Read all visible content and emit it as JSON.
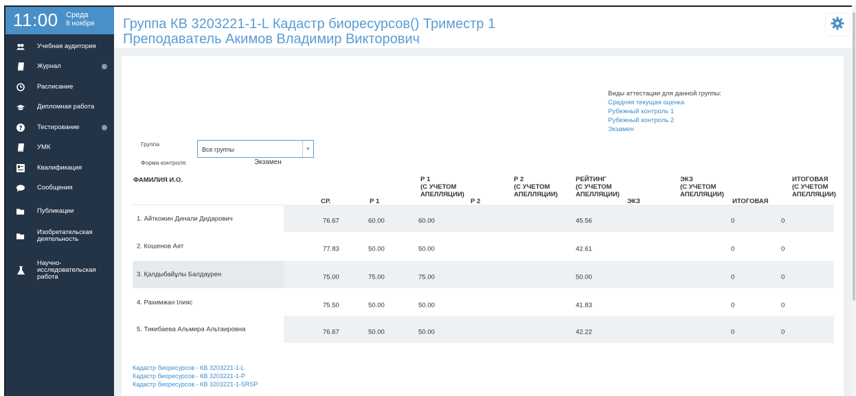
{
  "clock": {
    "time": "11:00",
    "day": "Среда",
    "date": "8 ноября"
  },
  "sidebar": {
    "items": [
      {
        "label": "Учебная аудитория",
        "icon": "users-icon",
        "has_sub": false
      },
      {
        "label": "Журнал",
        "icon": "book-icon",
        "has_sub": true
      },
      {
        "label": "Расписание",
        "icon": "clock-icon",
        "has_sub": false
      },
      {
        "label": "Дипломная работа",
        "icon": "graduation-cap-icon",
        "has_sub": false
      },
      {
        "label": "Тестирование",
        "icon": "question-icon",
        "has_sub": true
      },
      {
        "label": "УМК",
        "icon": "book-icon",
        "has_sub": false
      },
      {
        "label": "Квалификация",
        "icon": "id-card-icon",
        "has_sub": false
      },
      {
        "label": "Сообщения",
        "icon": "chat-icon",
        "has_sub": false
      },
      {
        "label": "Публикации",
        "icon": "folder-icon",
        "has_sub": false
      },
      {
        "label": "Изобретательская\nдеятельность",
        "icon": "folder-icon",
        "has_sub": false
      },
      {
        "label": "Научно-\nисследовательская\nработа",
        "icon": "flask-icon",
        "has_sub": false
      }
    ]
  },
  "header": {
    "title_line1": "Группа КВ 3203221-1-L Кадастр биоресурсов() Триместр 1",
    "title_line2": "Преподаватель Акимов Владимир Викторович",
    "settings_icon": "gear-icon"
  },
  "attestation": {
    "title": "Виды аттестации для данной группы:",
    "links": [
      "Средняя текущая оценка",
      "Рубежный контроль 1",
      "Рубежный контроль 2",
      "Экзамен"
    ]
  },
  "filters": {
    "group_label": "Группа",
    "group_value": "Все группы",
    "form_label": "Форма контроля:",
    "form_value": "Экзамен"
  },
  "table": {
    "headers": {
      "name": "ФАМИЛИЯ И.О.",
      "sr": "СР.",
      "r1": "Р 1",
      "r1_app": "Р 1\n(С УЧЕТОМ\nАПЕЛЛЯЦИИ)",
      "r2": "Р 2",
      "r2_app": "Р 2\n(С УЧЕТОМ\nАПЕЛЛЯЦИИ)",
      "rating_app": "РЕЙТИНГ\n(С УЧЕТОМ\nАПЕЛЛЯЦИИ)",
      "ekz": "ЭКЗ",
      "ekz_app": "ЭКЗ\n(С УЧЕТОМ\nАПЕЛЛЯЦИИ)",
      "final": "ИТОГОВАЯ",
      "final_app": "ИТОГОВАЯ\n(С УЧЕТОМ\nАПЕЛЛЯЦИИ)"
    },
    "rows": [
      {
        "name": "1. Айткожин Динали Дидарович",
        "sr": "76.67",
        "r1": "60.00",
        "r1_app": "60.00",
        "rating": "45.56",
        "final": "0",
        "final_app": "0"
      },
      {
        "name": "2. Кошенов Аят",
        "sr": "77.83",
        "r1": "50.00",
        "r1_app": "50.00",
        "rating": "42.61",
        "final": "0",
        "final_app": "0"
      },
      {
        "name": "3. Қалдыбайұлы Балдаурен",
        "sr": "75.00",
        "r1": "75.00",
        "r1_app": "75.00",
        "rating": "50.00",
        "final": "0",
        "final_app": "0"
      },
      {
        "name": "4. Рахимжан Ілияс",
        "sr": "75.50",
        "r1": "50.00",
        "r1_app": "50.00",
        "rating": "41.83",
        "final": "0",
        "final_app": "0"
      },
      {
        "name": "5. Тикибаева Альмира Альтаировна",
        "sr": "76.67",
        "r1": "50.00",
        "r1_app": "50.00",
        "rating": "42.22",
        "final": "0",
        "final_app": "0"
      }
    ]
  },
  "footer_links": [
    "Кадастр биоресурсов - КВ 3203221-1-L",
    "Кадастр биоресурсов - КВ 3203221-1-Р",
    "Кадастр биоресурсов - КВ 3203221-1-SRSP"
  ],
  "colors": {
    "accent": "#5b9bd5",
    "sidebar": "#243447",
    "clock": "#4a90c8",
    "link": "#3c8dcf"
  }
}
